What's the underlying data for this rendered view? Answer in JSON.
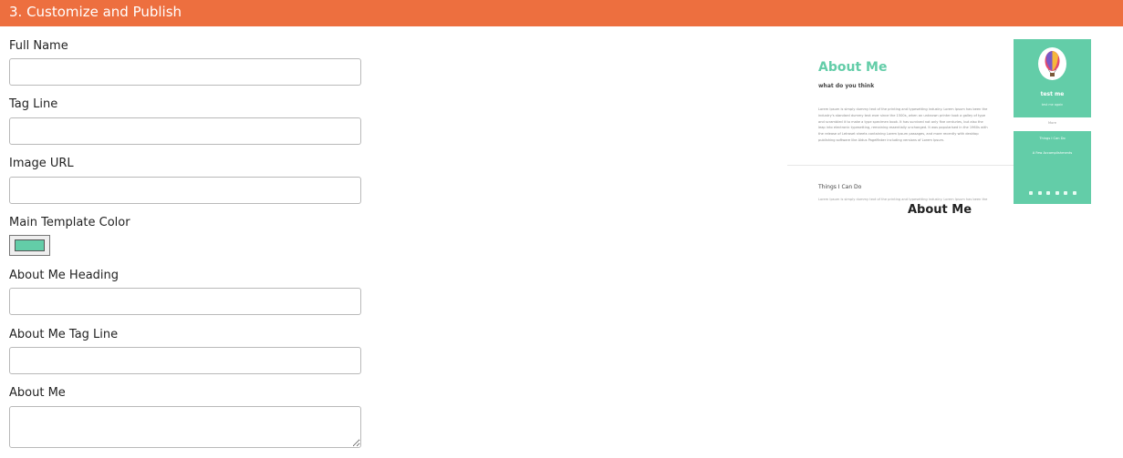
{
  "header": {
    "title": "3. Customize and Publish"
  },
  "form": {
    "full_name": {
      "label": "Full Name",
      "value": ""
    },
    "tag_line": {
      "label": "Tag Line",
      "value": ""
    },
    "image_url": {
      "label": "Image URL",
      "value": ""
    },
    "main_template_color": {
      "label": "Main Template Color",
      "value": "#63cda8"
    },
    "about_heading": {
      "label": "About Me Heading",
      "value": ""
    },
    "about_tag_line": {
      "label": "About Me Tag Line",
      "value": ""
    },
    "about_me": {
      "label": "About Me",
      "value": ""
    }
  },
  "preview": {
    "heading": "About Me",
    "tagline": "what do you think",
    "body": "Lorem Ipsum is simply dummy text of the printing and typesetting industry. Lorem Ipsum has been the industry's standard dummy text ever since the 1500s, when an unknown printer took a galley of type and scrambled it to make a type specimen book. It has survived not only five centuries, but also the leap into electronic typesetting, remaining essentially unchanged. It was popularised in the 1960s with the release of Letraset sheets containing Lorem Ipsum passages, and more recently with desktop publishing software like Aldus PageMaker including versions of Lorem Ipsum.",
    "section_title": "Things I Can Do",
    "section_body": "Lorem Ipsum is simply dummy text of the printing and typesetting industry. Lorem Ipsum has been the",
    "sidebar": {
      "name": "test me",
      "subtitle": "test me again",
      "more": "More",
      "item1": "Things I Can Do",
      "item2": "A Few Accomplishments"
    },
    "avatar_icon": "hot-air-balloon-icon",
    "social_icons": [
      "email-icon",
      "twitter-icon",
      "facebook-icon",
      "linkedin-icon",
      "instagram-icon",
      "github-icon"
    ],
    "caption": "About Me"
  },
  "colors": {
    "header": "#ed6f3f",
    "accent": "#63cda8"
  }
}
